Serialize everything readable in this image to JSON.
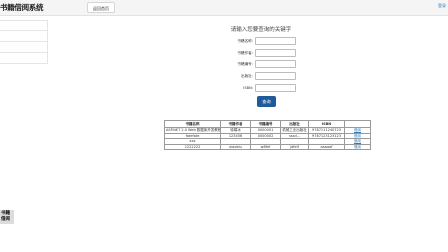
{
  "header": {
    "brand_title": "书籍借阅系统",
    "nav_button_label": "返回首页",
    "right_link_label": "登录"
  },
  "search_form": {
    "title": "请输入您要查询的关键字",
    "fields": [
      {
        "label": "书籍名称:",
        "value": ""
      },
      {
        "label": "书籍作者:",
        "value": ""
      },
      {
        "label": "书籍编号:",
        "value": ""
      },
      {
        "label": "出版社:",
        "value": ""
      },
      {
        "label": "ISBN:",
        "value": ""
      }
    ],
    "search_button_label": "查询"
  },
  "results_table": {
    "columns": [
      "书籍名称",
      "书籍作者",
      "书籍编号",
      "出版社",
      "ISBN",
      ""
    ],
    "rows": [
      [
        "ASP.NET 2.0 Web 数据库开发教程",
        "徐娟冰",
        "0000001",
        "机械工业出版社",
        "9787111240723",
        "借阅"
      ],
      [
        "fatefate",
        "123456",
        "0000002",
        "sssd...",
        "9787123123123",
        "借阅"
      ],
      [
        "xxx",
        "",
        "",
        "",
        "",
        "借阅"
      ],
      [
        "1222222",
        "xiaobiu",
        "w8fef",
        "jdfelf",
        "aaaaaf",
        "借阅"
      ]
    ]
  },
  "corner_thumbnail": {
    "line1": "书籍",
    "line2": "借阅"
  }
}
